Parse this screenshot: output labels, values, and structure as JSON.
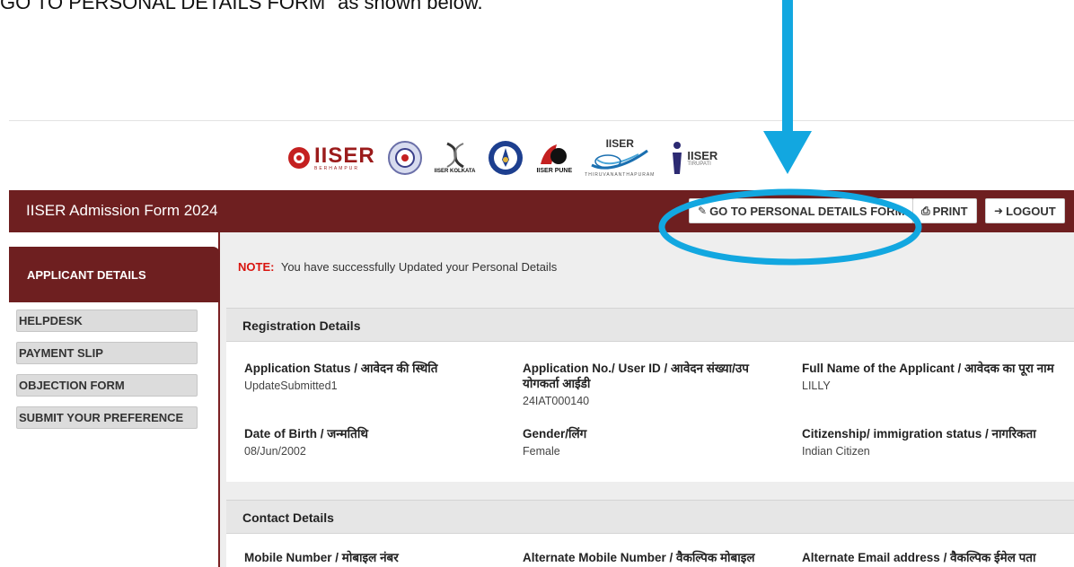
{
  "instruction": {
    "text": "GO TO PERSONAL DETAILS FORM\" as shown below."
  },
  "logos": [
    {
      "text": "IISER",
      "subtext": "BERHAMPUR"
    },
    {
      "text": ""
    },
    {
      "text": "IISER KOLKATA"
    },
    {
      "text": ""
    },
    {
      "text": "IISER PUNE"
    },
    {
      "text": "IISER",
      "subtext": "THIRUVANANTHAPURAM"
    },
    {
      "text": "IISER",
      "subtext": "TIRUPATI"
    }
  ],
  "header": {
    "title": "IISER Admission Form 2024",
    "buttons": [
      {
        "label": "GO TO PERSONAL DETAILS FORM",
        "icon": "edit-icon"
      },
      {
        "label": "PRINT",
        "icon": "print-icon"
      },
      {
        "label": "LOGOUT",
        "icon": "logout-icon"
      }
    ]
  },
  "sidebar": {
    "active_tab": "APPLICANT DETAILS",
    "items": [
      "HELPDESK",
      "PAYMENT SLIP",
      "OBJECTION FORM",
      "SUBMIT YOUR PREFERENCE"
    ]
  },
  "note": {
    "label": "NOTE:",
    "text": "You have successfully Updated your Personal Details"
  },
  "registration": {
    "heading": "Registration Details",
    "fields": [
      {
        "label": "Application Status / आवेदन की स्थिति",
        "value": "UpdateSubmitted1"
      },
      {
        "label": "Application No./ User ID / आवेदन संख्या/उप योगकर्ता आईडी",
        "value": "24IAT000140"
      },
      {
        "label": "Full Name of the Applicant / आवेदक का पूरा नाम",
        "value": "LILLY"
      },
      {
        "label": "Date of Birth / जन्मतिथि",
        "value": "08/Jun/2002"
      },
      {
        "label": "Gender/लिंग",
        "value": "Female"
      },
      {
        "label": "Citizenship/ immigration status / नागरिकता",
        "value": "Indian Citizen"
      }
    ]
  },
  "contact": {
    "heading": "Contact Details",
    "fields": [
      {
        "label": "Mobile Number / मोबाइल नंबर"
      },
      {
        "label": "Alternate Mobile Number / वैकल्पिक मोबाइल"
      },
      {
        "label": "Alternate Email address / वैकल्पिक ईमेल पता"
      }
    ]
  },
  "colors": {
    "navbar": "#6e1f20",
    "note_label": "#d9140e",
    "annotation": "#12a7e0"
  }
}
